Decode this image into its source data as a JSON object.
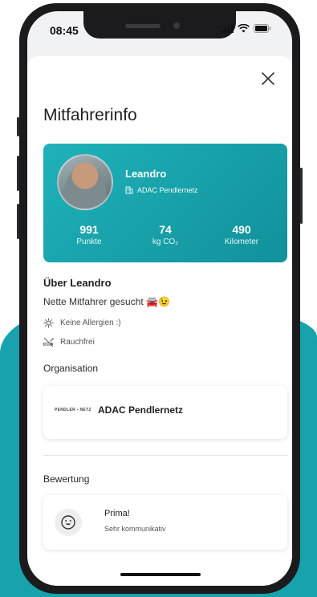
{
  "status_bar": {
    "time": "08:45"
  },
  "sheet": {
    "title": "Mitfahrerinfo"
  },
  "profile": {
    "name": "Leandro",
    "organization": "ADAC Pendlernetz",
    "stats": [
      {
        "value": "991",
        "label": "Punkte"
      },
      {
        "value": "74",
        "label": "kg CO₂"
      },
      {
        "value": "490",
        "label": "Kilometer"
      }
    ]
  },
  "about": {
    "heading": "Über Leandro",
    "text": "Nette Mitfahrer gesucht 🚘😉",
    "items": [
      {
        "icon": "allergy-icon",
        "label": "Keine Allergien :)"
      },
      {
        "icon": "no-smoking-icon",
        "label": "Rauchfrei"
      }
    ]
  },
  "organisation": {
    "heading": "Organisation",
    "logo_text": "PENDLER ▪ NETZ",
    "name": "ADAC Pendlernetz"
  },
  "rating": {
    "heading": "Bewertung",
    "icon": "smiley-icon",
    "title": "Prima!",
    "subtitle": "Sehr kommunikativ"
  },
  "colors": {
    "accent": "#17a2ad",
    "card_gradient_start": "#1fb2b9",
    "card_gradient_end": "#11919b"
  }
}
